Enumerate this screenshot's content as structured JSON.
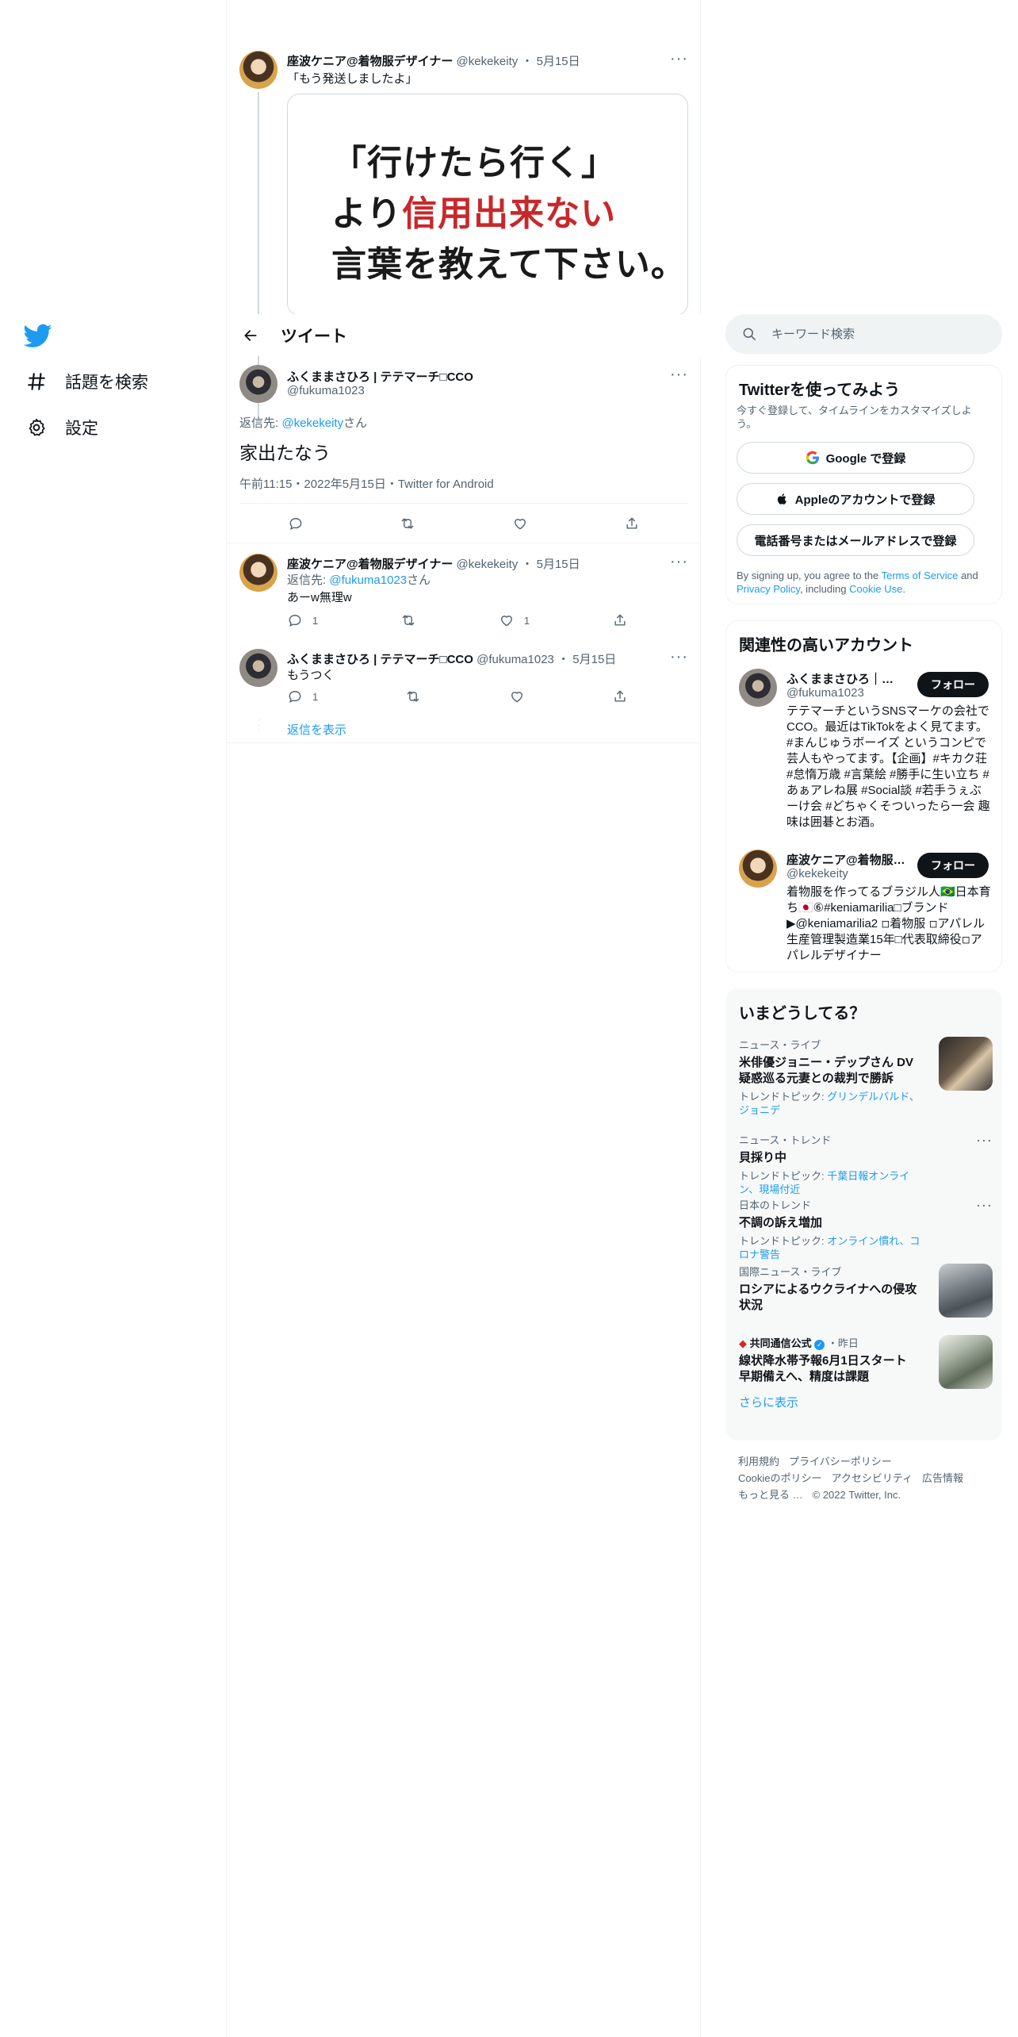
{
  "nav": {
    "items": [
      {
        "label": "話題を検索",
        "icon": "hash-icon"
      },
      {
        "label": "設定",
        "icon": "gear-icon"
      }
    ]
  },
  "header": {
    "title": "ツイート"
  },
  "parent_tweet": {
    "name": "座波ケニア@着物服デザイナー",
    "handle": "@kekekeity",
    "date": "5月15日",
    "text": "「もう発送しましたよ」",
    "image_lines": [
      "「行けたら行く」",
      "より",
      "信用出来ない",
      "言葉を教えて下さい。"
    ]
  },
  "main_tweet": {
    "name": "ふくままさひろ | テテマーチ□CCO",
    "handle": "@fukuma1023",
    "reply_to_prefix": "返信先: ",
    "reply_to_handle": "@kekekeity",
    "reply_to_suffix": "さん",
    "text": "家出たなう",
    "timestamp": "午前11:15・2022年5月15日・Twitter for Android"
  },
  "replies": [
    {
      "name": "座波ケニア@着物服デザイナー",
      "handle": "@kekekeity",
      "date": "5月15日",
      "reply_to_prefix": "返信先: ",
      "reply_to_handle": "@fukuma1023",
      "reply_to_suffix": "さん",
      "text": "あーw無理w",
      "reply_count": "1",
      "like_count": "1"
    },
    {
      "name": "ふくままさひろ | テテマーチ□CCO",
      "handle": "@fukuma1023",
      "date": "5月15日",
      "text": "もうつく",
      "reply_count": "1"
    }
  ],
  "show_replies": "返信を表示",
  "search": {
    "placeholder": "キーワード検索"
  },
  "signup": {
    "title": "Twitterを使ってみよう",
    "subtitle": "今すぐ登録して、タイムラインをカスタマイズしよう。",
    "google": "Google で登録",
    "apple": "Appleのアカウントで登録",
    "phone": "電話番号またはメールアドレスで登録",
    "terms_1": "By signing up, you agree to the ",
    "terms_link_1": "Terms of Service",
    "terms_2": " and ",
    "terms_link_2": "Privacy Policy",
    "terms_3": ", including ",
    "terms_link_3": "Cookie Use",
    "terms_4": "."
  },
  "related": {
    "title": "関連性の高いアカウント",
    "follow_label": "フォロー",
    "accounts": [
      {
        "name": "ふくままさひろ｜テテマーチ□CCO",
        "handle": "@fukuma1023",
        "bio": "テテマーチというSNSマーケの会社でCCO。最近はTikTokをよく見てます。#まんじゅうボーイズ というコンピで芸人もやってます。【企画】#キカク荘 #怠惰万歳 #言葉絵 #勝手に生い立ち #あぁアレね展 #Social談 #若手うぇぶーけ会 #どちゃくそついったら一会 趣味は囲碁とお酒。"
      },
      {
        "name": "座波ケニア@着物服デザイナー",
        "handle": "@kekekeity",
        "bio": "着物服を作ってるブラジル人🇧🇷日本育ち🇯🇵⑥#keniamarilia□ブランド▶@keniamarilia2 ◽着物服 ◽アパレル生産管理製造業15年□代表取締役◽アパレルデザイナー"
      }
    ]
  },
  "trends": {
    "title": "いまどうしてる？",
    "items": [
      {
        "category": "ニュース・ライブ",
        "title": "米俳優ジョニー・デップさん DV疑惑巡る元妻との裁判で勝訴",
        "topic_prefix": "トレンドトピック: ",
        "topic": "グリンデルバルド、ジョニデ"
      },
      {
        "category": "ニュース・トレンド",
        "title": "貝採り中",
        "topic_prefix": "トレンドトピック: ",
        "topic": "千葉日報オンライン、現場付近"
      },
      {
        "category": "日本のトレンド",
        "title": "不調の訴え増加",
        "topic_prefix": "トレンドトピック: ",
        "topic": "オンライン慣れ、コロナ警告"
      },
      {
        "category": "国際ニュース・ライブ",
        "title": "ロシアによるウクライナへの侵攻状況"
      },
      {
        "category": "共同通信公式",
        "category_time": "・昨日",
        "title": "線状降水帯予報6月1日スタート 早期備えへ、精度は課題"
      }
    ],
    "show_more": "さらに表示"
  },
  "footer": {
    "links": [
      "利用規約",
      "プライバシーポリシー",
      "Cookieのポリシー",
      "アクセシビリティ",
      "広告情報",
      "もっと見る …"
    ],
    "copyright": "© 2022 Twitter, Inc."
  },
  "colors": {
    "accent": "#1d9bf0",
    "text": "#0f1419",
    "muted": "#536471",
    "border": "#eff3f4"
  }
}
